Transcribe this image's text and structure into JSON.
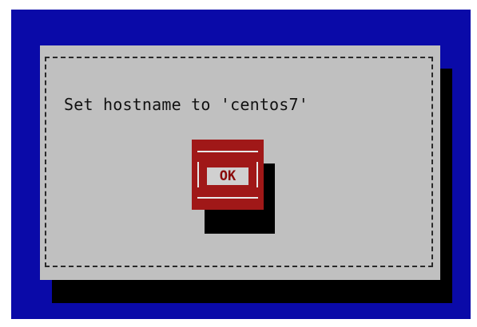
{
  "dialog": {
    "message": "Set hostname to 'centos7'",
    "ok_label": "OK"
  },
  "colors": {
    "screen_background": "#0a0aa8",
    "dialog_background": "#c0c0c0",
    "button_focus": "#a01818",
    "shadow": "#000000"
  }
}
